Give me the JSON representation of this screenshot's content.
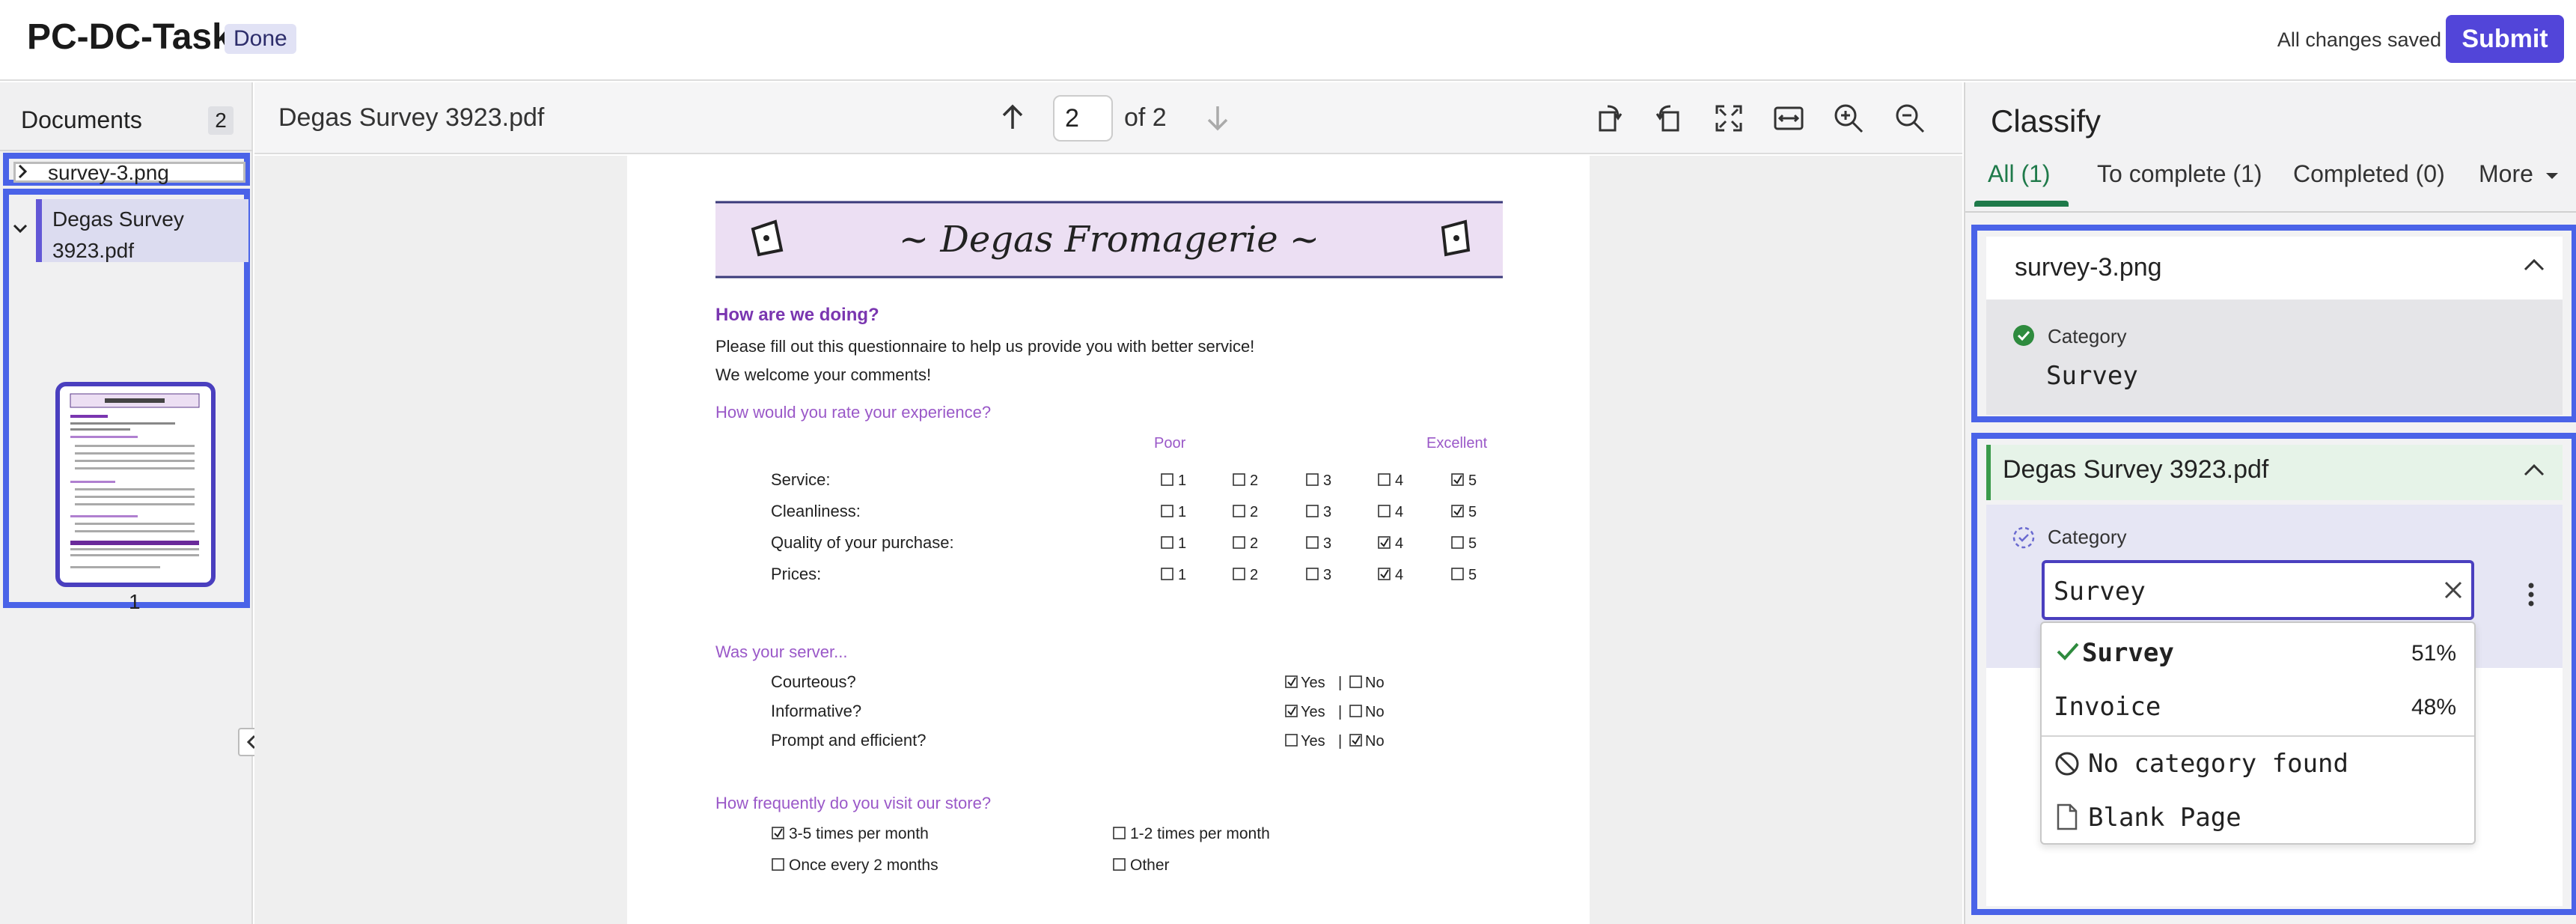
{
  "header": {
    "app_title": "PC-DC-Task",
    "status_badge": "Done",
    "saved_text": "All changes saved",
    "submit_label": "Submit"
  },
  "documents": {
    "title": "Documents",
    "count": "2",
    "items": [
      {
        "label": "survey-3.png",
        "expanded": false
      },
      {
        "label": "Degas Survey 3923.pdf",
        "expanded": true,
        "page_number": "1"
      }
    ]
  },
  "viewer": {
    "filename": "Degas Survey 3923.pdf",
    "current_page": "2",
    "page_of": "of 2",
    "tools": [
      "rotate-right-icon",
      "rotate-left-icon",
      "fit-page-icon",
      "fit-width-icon",
      "zoom-in-icon",
      "zoom-out-icon"
    ]
  },
  "pdf": {
    "banner_title": "~ Degas Fromagerie ~",
    "question_heading": "How are we doing?",
    "intro_line1": "Please fill out this questionnaire to help us provide you with better service!",
    "intro_line2": "We welcome your comments!",
    "rate_heading": "How would you rate your experience?",
    "scale_low": "Poor",
    "scale_high": "Excellent",
    "rating_rows": [
      {
        "label": "Service:",
        "checked": 5
      },
      {
        "label": "Cleanliness:",
        "checked": 5
      },
      {
        "label": "Quality of your purchase:",
        "checked": 4
      },
      {
        "label": "Prices:",
        "checked": 4
      }
    ],
    "scale_values": [
      "1",
      "2",
      "3",
      "4",
      "5"
    ],
    "server_heading": "Was your server...",
    "server_rows": [
      {
        "label": "Courteous?",
        "yes": true
      },
      {
        "label": "Informative?",
        "yes": true
      },
      {
        "label": "Prompt and efficient?",
        "yes": false
      }
    ],
    "yes_label": "Yes",
    "no_label": "No",
    "freq_heading": "How frequently do you visit our store?",
    "freq_options": [
      {
        "label": "3-5 times per month",
        "checked": true
      },
      {
        "label": "1-2 times per month",
        "checked": false
      },
      {
        "label": "Once every 2 months",
        "checked": false
      },
      {
        "label": "Other",
        "checked": false
      }
    ]
  },
  "classify": {
    "title": "Classify",
    "tabs": [
      {
        "label": "All (1)",
        "active": true
      },
      {
        "label": "To complete (1)",
        "active": false
      },
      {
        "label": "Completed (0)",
        "active": false
      },
      {
        "label": "More",
        "active": false
      }
    ],
    "cards": [
      {
        "title": "survey-3.png",
        "category_label": "Category",
        "category_value": "Survey",
        "status": "confirmed"
      },
      {
        "title": "Degas Survey 3923.pdf",
        "category_label": "Category",
        "input_value": "Survey",
        "status": "pending"
      }
    ],
    "dropdown": [
      {
        "label": "Survey",
        "pct": "51%",
        "selected": true
      },
      {
        "label": "Invoice",
        "pct": "48%",
        "selected": false
      },
      {
        "label": "No category found",
        "icon": "ban-icon"
      },
      {
        "label": "Blank Page",
        "icon": "document-icon"
      }
    ]
  },
  "colors": {
    "accent": "#5245d9",
    "highlight": "#4a63e8",
    "success": "#1f7a4a",
    "pdf_purple": "#7a36b0"
  }
}
